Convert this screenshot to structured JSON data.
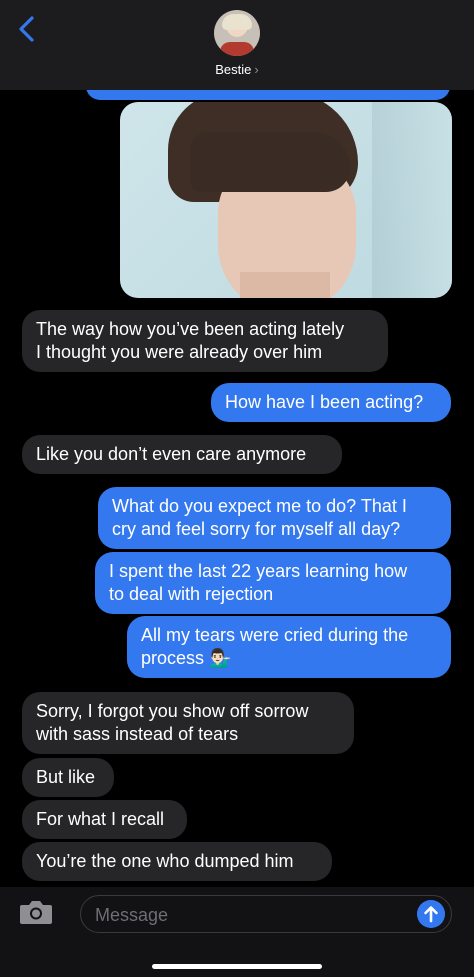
{
  "header": {
    "contact_name": "Bestie",
    "chevron": "›",
    "back_icon": "chevron-left-icon",
    "accent": "#3478f0"
  },
  "messages": [
    {
      "side": "in",
      "text": "The way how you’ve been acting lately\nI thought you were already over him"
    },
    {
      "side": "out",
      "text": "How have I been acting?"
    },
    {
      "side": "in",
      "text": "Like you don’t even care anymore"
    },
    {
      "side": "out",
      "text": "What do you expect me to do? That I\ncry and feel sorry for myself all day?"
    },
    {
      "side": "out",
      "text": "I spent the last 22 years learning how\nto deal with rejection"
    },
    {
      "side": "out",
      "text": "All my tears were cried during the\nprocess 💁🏻‍♂️"
    },
    {
      "side": "in",
      "text": "Sorry, I forgot you show off sorrow\nwith sass instead of tears"
    },
    {
      "side": "in",
      "text": "But like"
    },
    {
      "side": "in",
      "text": "For what I recall"
    },
    {
      "side": "in",
      "text": "You’re the one who dumped him"
    }
  ],
  "input": {
    "placeholder": "Message",
    "camera_icon": "camera-icon",
    "send_icon": "arrow-up-icon"
  },
  "colors": {
    "incoming_bubble": "#262628",
    "outgoing_bubble": "#3478f0",
    "background": "#000000"
  }
}
